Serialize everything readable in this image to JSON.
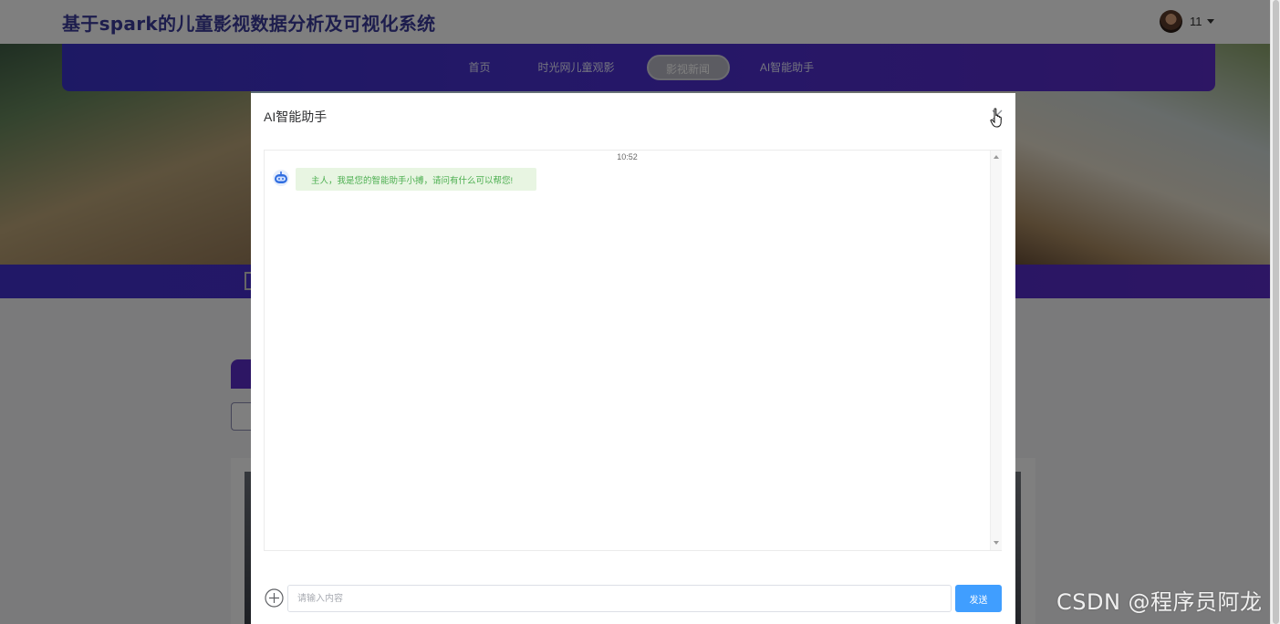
{
  "site": {
    "title": "基于spark的儿童影视数据分析及可视化系统",
    "user_name": "11"
  },
  "nav": {
    "items": [
      {
        "label": "首页",
        "active": false
      },
      {
        "label": "时光网儿童观影",
        "active": false
      },
      {
        "label": "影视新闻",
        "active": true
      },
      {
        "label": "AI智能助手",
        "active": false
      }
    ]
  },
  "dialog": {
    "title": "AI智能助手",
    "messages": [
      {
        "time": "10:52",
        "sender": "bot",
        "text": "主人，我是您的智能助手小搏，请问有什么可以帮您!"
      }
    ],
    "input": {
      "value": "",
      "placeholder": "请输入内容"
    },
    "send_label": "发送"
  },
  "watermark": "CSDN @程序员阿龙",
  "colors": {
    "nav_gradient_start": "#3b33c9",
    "nav_gradient_end": "#5a2cc8",
    "send_button": "#409eff",
    "bot_bubble_bg": "#e8f5e2",
    "bot_bubble_text": "#4caf50",
    "title_color": "#3a3a9a"
  }
}
